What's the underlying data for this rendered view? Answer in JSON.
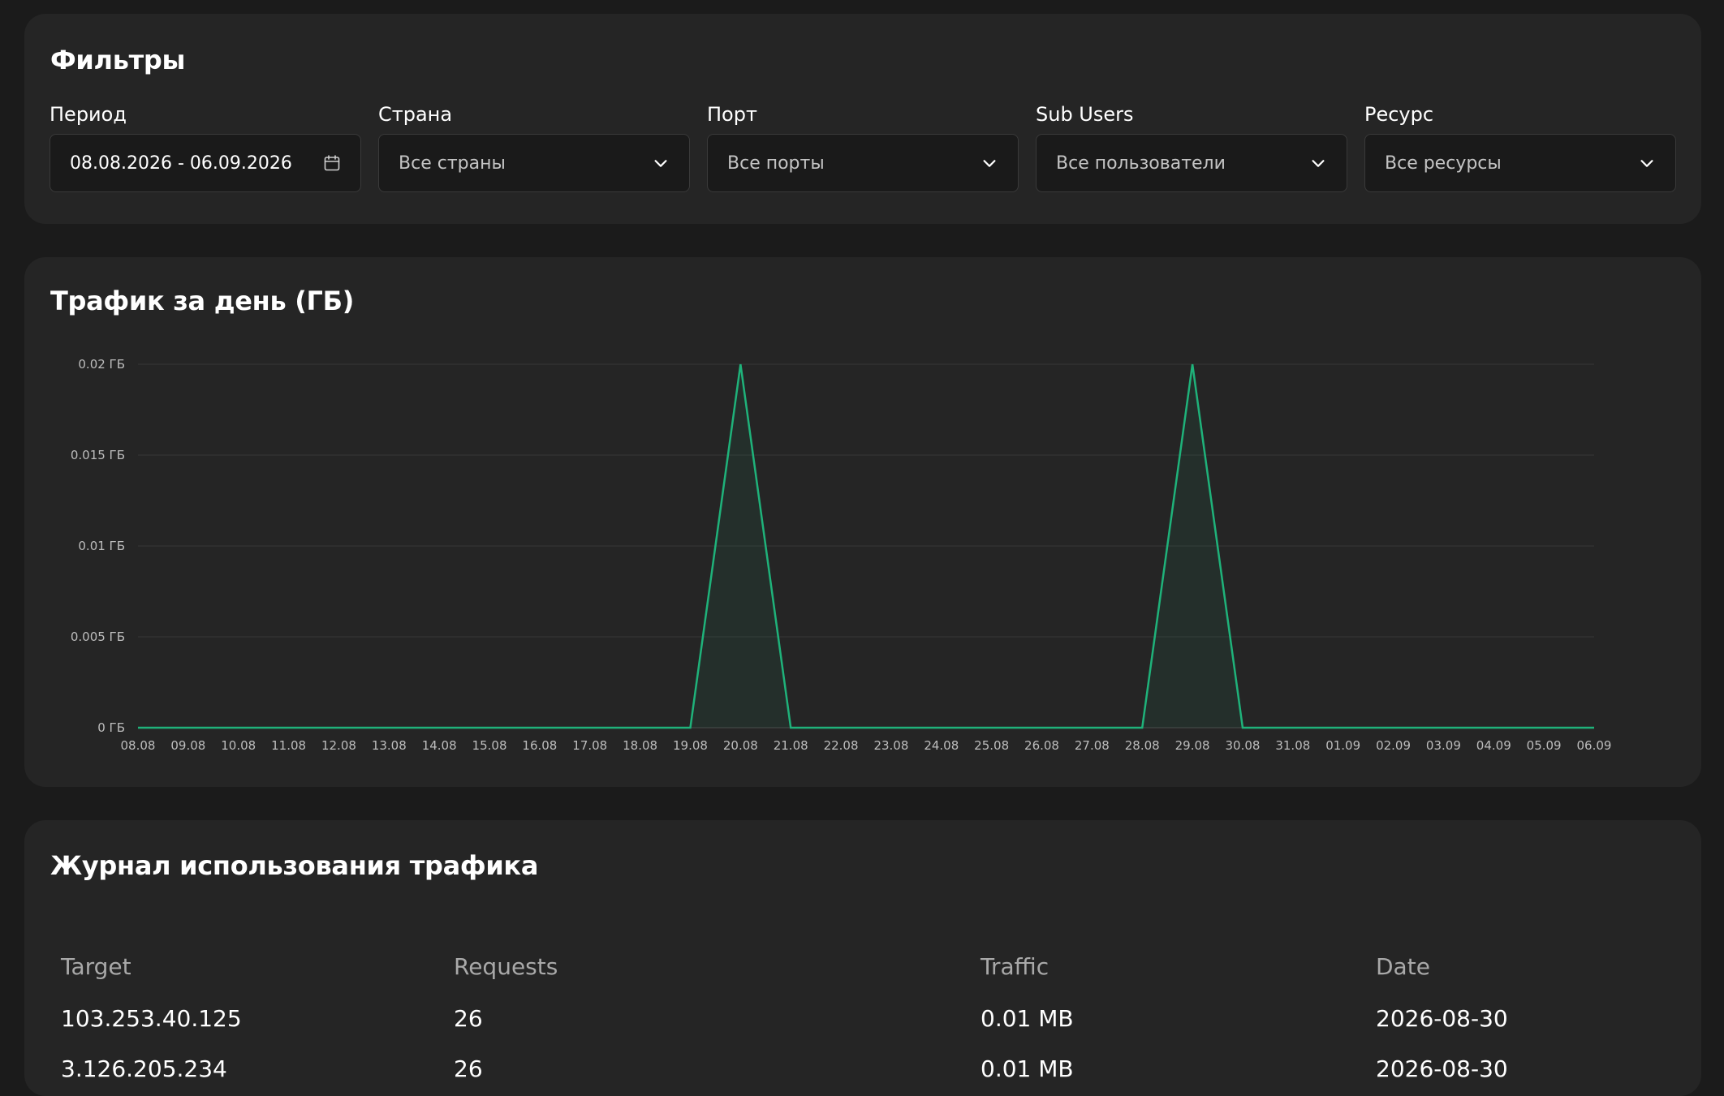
{
  "filters": {
    "title": "Фильтры",
    "items": [
      {
        "label": "Период",
        "value": "08.08.2026 - 06.09.2026",
        "icon": "calendar-icon"
      },
      {
        "label": "Страна",
        "value": "Все страны",
        "icon": "chevron-down-icon"
      },
      {
        "label": "Порт",
        "value": "Все порты",
        "icon": "chevron-down-icon"
      },
      {
        "label": "Sub Users",
        "value": "Все пользователи",
        "icon": "chevron-down-icon"
      },
      {
        "label": "Ресурс",
        "value": "Все ресурсы",
        "icon": "chevron-down-icon"
      }
    ]
  },
  "chart": {
    "title": "Трафик за день (ГБ)"
  },
  "chart_data": {
    "type": "line",
    "title": "Трафик за день (ГБ)",
    "xlabel": "",
    "ylabel": "",
    "x": [
      "08.08",
      "09.08",
      "10.08",
      "11.08",
      "12.08",
      "13.08",
      "14.08",
      "15.08",
      "16.08",
      "17.08",
      "18.08",
      "19.08",
      "20.08",
      "21.08",
      "22.08",
      "23.08",
      "24.08",
      "25.08",
      "26.08",
      "27.08",
      "28.08",
      "29.08",
      "30.08",
      "31.08",
      "01.09",
      "02.09",
      "03.09",
      "04.09",
      "05.09",
      "06.09"
    ],
    "series": [
      {
        "values": [
          0,
          0,
          0,
          0,
          0,
          0,
          0,
          0,
          0,
          0,
          0,
          0,
          0.02,
          0,
          0,
          0,
          0,
          0,
          0,
          0,
          0,
          0.02,
          0,
          0,
          0,
          0,
          0,
          0,
          0,
          0
        ],
        "color": "#1fb27a"
      }
    ],
    "ylim": [
      0,
      0.02
    ],
    "yticks": [
      0,
      0.005,
      0.01,
      0.015,
      0.02
    ],
    "ytick_labels": [
      "0 ГБ",
      "0.005 ГБ",
      "0.01 ГБ",
      "0.015 ГБ",
      "0.02 ГБ"
    ],
    "grid": true,
    "legend": "none"
  },
  "log": {
    "title": "Журнал использования трафика",
    "columns": [
      "Target",
      "Requests",
      "Traffic",
      "Date"
    ],
    "rows": [
      [
        "103.253.40.125",
        "26",
        "0.01 MB",
        "2026-08-30"
      ],
      [
        "3.126.205.234",
        "26",
        "0.01 MB",
        "2026-08-30"
      ]
    ]
  },
  "colors": {
    "background": "#1b1b1b",
    "card": "#252525",
    "input": "#1a1a1a",
    "accent": "#1fb27a"
  }
}
